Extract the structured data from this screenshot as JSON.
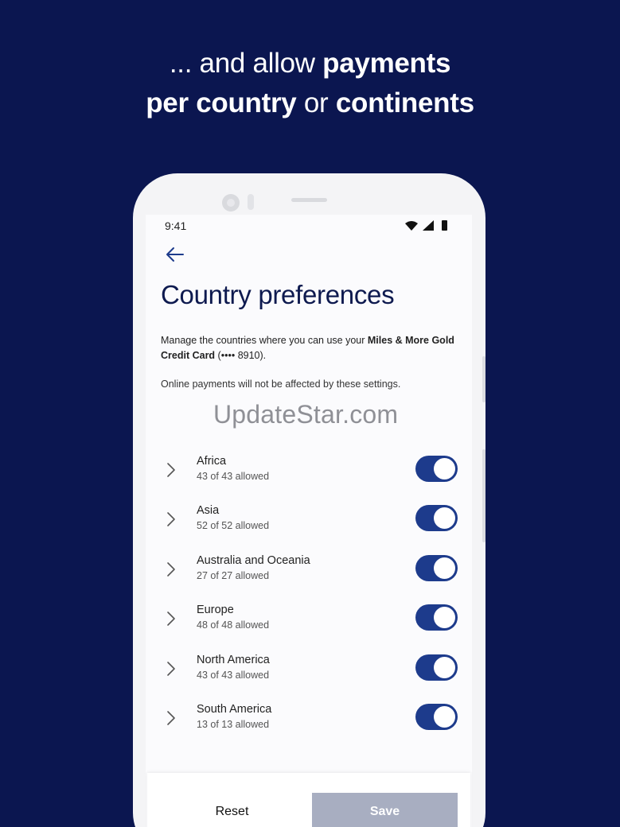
{
  "headline": {
    "line1_pre": "... and allow ",
    "line1_bold": "payments",
    "line2_bold1": "per country",
    "line2_mid": " or ",
    "line2_bold2": "continents"
  },
  "status_bar": {
    "time": "9:41",
    "icons": [
      "wifi-icon",
      "signal-icon",
      "battery-icon"
    ]
  },
  "page": {
    "title": "Country preferences",
    "description_pre": "Manage the countries where you can use your ",
    "description_card": "Miles & More Gold Credit Card",
    "description_post": " (•••• 8910).",
    "note": "Online payments will not be affected by these settings."
  },
  "watermark": "UpdateStar.com",
  "regions": [
    {
      "name": "Africa",
      "status": "43 of 43 allowed",
      "enabled": true
    },
    {
      "name": "Asia",
      "status": "52 of 52 allowed",
      "enabled": true
    },
    {
      "name": "Australia and Oceania",
      "status": "27 of 27 allowed",
      "enabled": true
    },
    {
      "name": "Europe",
      "status": "48 of 48 allowed",
      "enabled": true
    },
    {
      "name": "North America",
      "status": "43 of 43 allowed",
      "enabled": true
    },
    {
      "name": "South America",
      "status": "13 of 13 allowed",
      "enabled": true
    }
  ],
  "actions": {
    "reset_label": "Reset",
    "save_label": "Save"
  },
  "colors": {
    "background": "#0b1650",
    "accent": "#1d3b8c",
    "title": "#0e1a4f",
    "save_disabled": "#a8aec1"
  }
}
